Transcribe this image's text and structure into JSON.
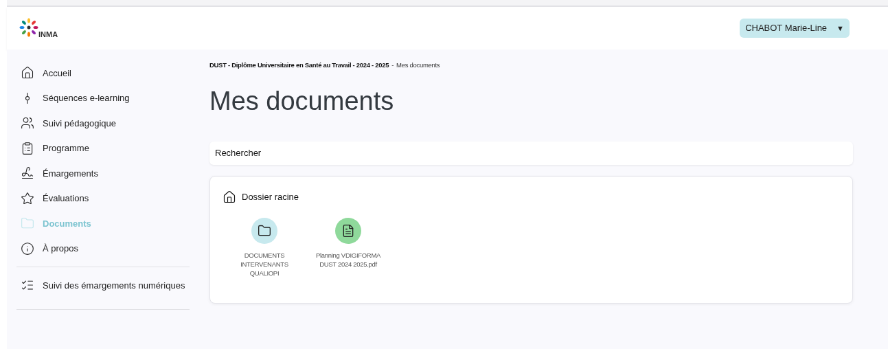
{
  "header": {
    "logo_text": "INMA",
    "user_menu": {
      "label": "CHABOT Marie-Line",
      "caret": "▼"
    }
  },
  "sidebar": {
    "items": [
      {
        "label": "Accueil",
        "selected": false
      },
      {
        "label": "Séquences e-learning",
        "selected": false
      },
      {
        "label": "Suivi pédagogique",
        "selected": false
      },
      {
        "label": "Programme",
        "selected": false
      },
      {
        "label": "Émargements",
        "selected": false
      },
      {
        "label": "Évaluations",
        "selected": false
      },
      {
        "label": "Documents",
        "selected": true
      },
      {
        "label": "À propos",
        "selected": false
      }
    ],
    "extra_items": [
      {
        "label": "Suivi des émargements numériques",
        "selected": false
      }
    ]
  },
  "breadcrumb": {
    "path": "DUST - Diplôme Universitaire en Santé au Travail - 2024 - 2025",
    "separator": "-",
    "current": "Mes documents"
  },
  "title": "Mes documents",
  "search": {
    "placeholder": "Rechercher"
  },
  "folder": {
    "title": "Dossier racine",
    "entries": [
      {
        "kind": "folder",
        "name": "DOCUMENTS INTERVENANTS QUALIOPI"
      },
      {
        "kind": "file",
        "name": "Planning VDIGIFORMA DUST 2024 2025.pdf"
      }
    ]
  }
}
